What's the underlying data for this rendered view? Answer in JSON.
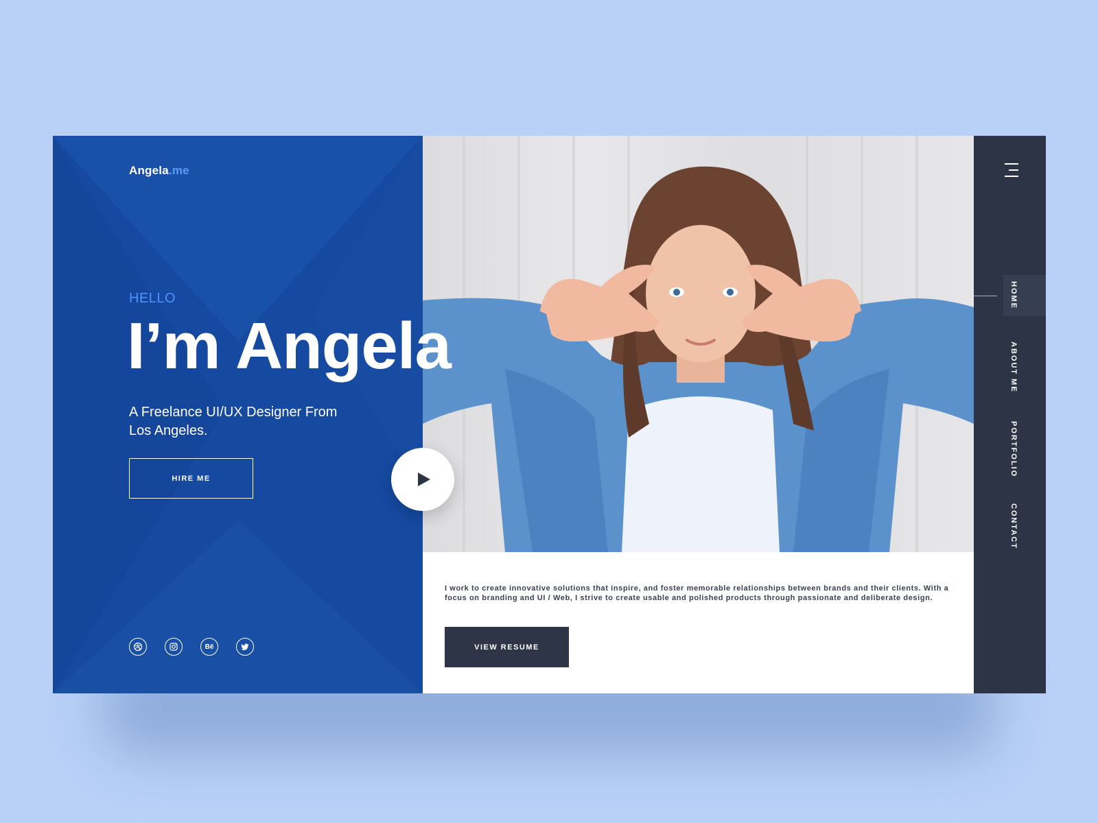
{
  "brand": {
    "name": "Angela",
    "suffix": ".me"
  },
  "hero": {
    "greeting": "HELLO",
    "headline": "I’m Angela",
    "subtitle": "A Freelance UI/UX Designer From Los Angeles.",
    "hire_label": "HIRE ME"
  },
  "socials": [
    {
      "icon": "dribbble-icon"
    },
    {
      "icon": "instagram-icon"
    },
    {
      "icon": "behance-icon",
      "label": "Bē"
    },
    {
      "icon": "twitter-icon"
    }
  ],
  "about": {
    "text": "I work to create innovative solutions that inspire, and foster memorable relationships between brands and their clients. With a focus on branding and UI / Web, I strive to create usable and polished products through passionate and deliberate design.",
    "resume_label": "VIEW RESUME"
  },
  "nav": {
    "items": [
      {
        "label": "HOME"
      },
      {
        "label": "ABOUT ME"
      },
      {
        "label": "PORTFOLIO"
      },
      {
        "label": "CONTACT"
      }
    ],
    "active": "HOME"
  },
  "colors": {
    "background": "#b9d1f7",
    "panel_blue": "#154aa0",
    "accent": "#4f93ff",
    "nav_dark": "#2c3445",
    "button_dark": "#2d3546"
  }
}
